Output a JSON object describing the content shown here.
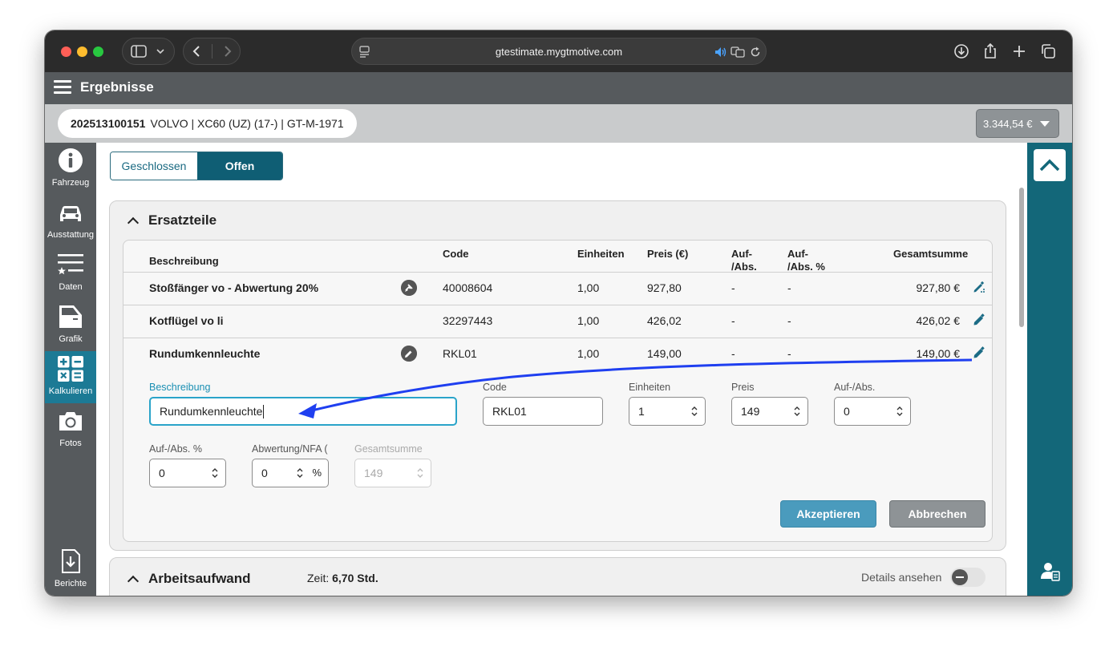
{
  "browser": {
    "url": "gtestimate.mygtmotive.com"
  },
  "app": {
    "title": "Ergebnisse",
    "vehicle_id": "202513100151",
    "vehicle_desc": "VOLVO | XC60 (UZ) (17-) | GT-M-1971",
    "total_price": "3.344,54 €"
  },
  "sidebar": {
    "items": [
      {
        "label": "Fahrzeug",
        "icon": "info-icon"
      },
      {
        "label": "Ausstattung",
        "icon": "car-icon"
      },
      {
        "label": "Daten",
        "icon": "list-star-icon"
      },
      {
        "label": "Grafik",
        "icon": "car-door-icon"
      },
      {
        "label": "Kalkulieren",
        "icon": "calculator-icon"
      },
      {
        "label": "Fotos",
        "icon": "camera-icon"
      },
      {
        "label": "Berichte",
        "icon": "report-download-icon"
      }
    ]
  },
  "filter": {
    "closed": "Geschlossen",
    "open": "Offen"
  },
  "parts": {
    "title": "Ersatzteile",
    "headers": {
      "desc": "Beschreibung",
      "code": "Code",
      "units": "Einheiten",
      "price": "Preis (€)",
      "surcharge_a": "Auf-",
      "surcharge_b": "/Abs.",
      "surcharge_pct_a": "Auf-",
      "surcharge_pct_b": "/Abs. %",
      "total": "Gesamtsumme"
    },
    "rows": [
      {
        "desc": "Stoßfänger vo - Abwertung 20%",
        "code": "40008604",
        "units": "1,00",
        "price": "927,80",
        "surcharge": "-",
        "surcharge_pct": "-",
        "total": "927,80 €"
      },
      {
        "desc": "Kotflügel vo li",
        "code": "32297443",
        "units": "1,00",
        "price": "426,02",
        "surcharge": "-",
        "surcharge_pct": "-",
        "total": "426,02 €"
      },
      {
        "desc": "Rundumkennleuchte",
        "code": "RKL01",
        "units": "1,00",
        "price": "149,00",
        "surcharge": "-",
        "surcharge_pct": "-",
        "total": "149,00 €"
      }
    ]
  },
  "edit": {
    "desc_label": "Beschreibung",
    "desc_value": "Rundumkennleuchte",
    "code_label": "Code",
    "code_value": "RKL01",
    "units_label": "Einheiten",
    "units_value": "1",
    "price_label": "Preis",
    "price_value": "149",
    "surcharge_label": "Auf-/Abs.",
    "surcharge_value": "0",
    "surcharge_pct_label": "Auf-/Abs. %",
    "surcharge_pct_value": "0",
    "depreciation_label": "Abwertung/NFA (",
    "depreciation_value": "0",
    "depreciation_unit": "%",
    "total_label": "Gesamtsumme",
    "total_value": "149",
    "accept": "Akzeptieren",
    "cancel": "Abbrechen"
  },
  "labor": {
    "title": "Arbeitsaufwand",
    "time_label": "Zeit:",
    "time_value": "6,70 Std.",
    "details": "Details ansehen"
  },
  "colors": {
    "teal_dark": "#0f5e74",
    "teal_active": "#1c7a95",
    "accept_btn": "#4a9bbd",
    "cancel_btn": "#8e9396",
    "annotation_arrow": "#1f3ff0"
  }
}
